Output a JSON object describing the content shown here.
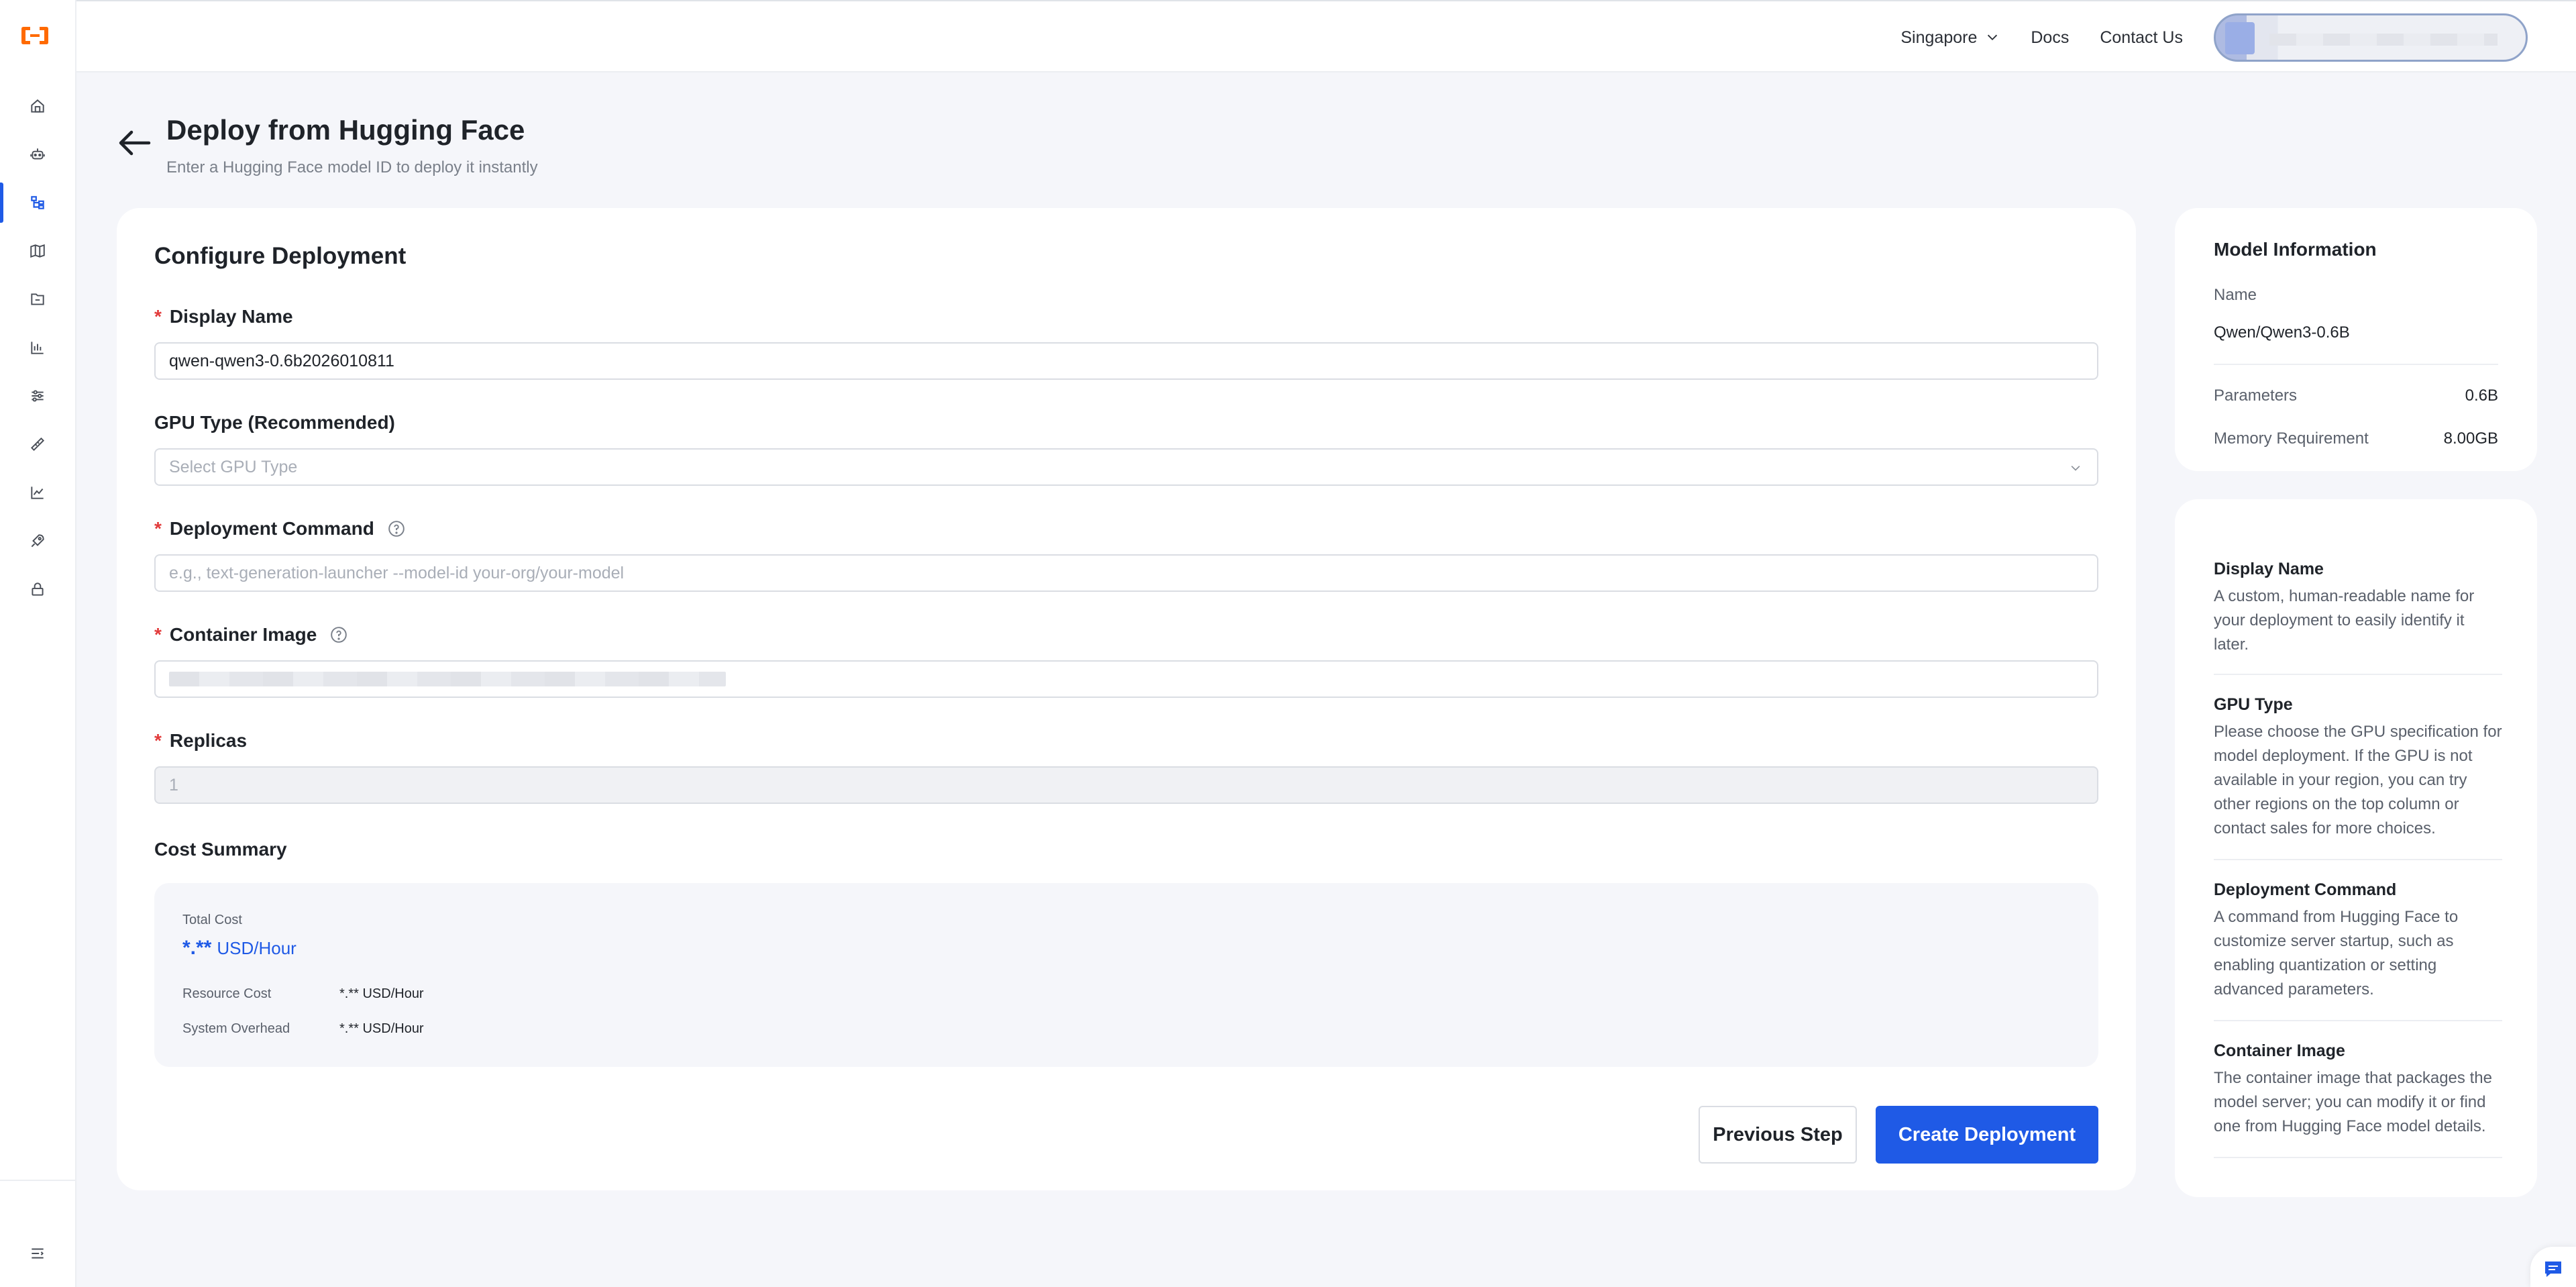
{
  "topbar": {
    "region": "Singapore",
    "docs": "Docs",
    "contact": "Contact Us"
  },
  "header": {
    "title": "Deploy from Hugging Face",
    "subtitle": "Enter a Hugging Face model ID to deploy it instantly"
  },
  "form": {
    "title": "Configure Deployment",
    "display_name": {
      "label": "Display Name",
      "value": "qwen-qwen3-0.6b2026010811"
    },
    "gpu_type": {
      "label": "GPU Type (Recommended)",
      "placeholder": "Select GPU Type"
    },
    "deployment_command": {
      "label": "Deployment Command",
      "placeholder": "e.g., text-generation-launcher --model-id your-org/your-model"
    },
    "container_image": {
      "label": "Container Image"
    },
    "replicas": {
      "label": "Replicas",
      "value": "1"
    }
  },
  "cost": {
    "title": "Cost Summary",
    "total_label": "Total Cost",
    "total_value": "*.**",
    "total_unit": "USD/Hour",
    "resource_label": "Resource Cost",
    "resource_value": "*.** USD/Hour",
    "overhead_label": "System Overhead",
    "overhead_value": "*.** USD/Hour"
  },
  "buttons": {
    "previous": "Previous Step",
    "create": "Create Deployment"
  },
  "model_info": {
    "title": "Model Information",
    "name_label": "Name",
    "name_value": "Qwen/Qwen3-0.6B",
    "params_label": "Parameters",
    "params_value": "0.6B",
    "memory_label": "Memory Requirement",
    "memory_value": "8.00GB"
  },
  "help": {
    "display_name_title": "Display Name",
    "display_name_text": "A custom, human-readable name for your deployment to easily identify it later.",
    "gpu_title": "GPU Type",
    "gpu_text": "Please choose the GPU specification for model deployment. If the GPU is not available in your region, you can try other regions on the top column or contact sales for more choices.",
    "command_title": "Deployment Command",
    "command_text": "A command from Hugging Face to customize server startup, such as enabling quantization or setting advanced parameters.",
    "image_title": "Container Image",
    "image_text": "The container image that packages the model server; you can modify it or find one from Hugging Face model details."
  },
  "colors": {
    "accent": "#1f5ae6",
    "logo": "#ff6a00",
    "required": "#e23b3b"
  },
  "icons": [
    "logo-icon",
    "home-icon",
    "robot-icon",
    "tree-icon",
    "map-icon",
    "folder-icon",
    "bar-chart-icon",
    "sliders-icon",
    "ruler-icon",
    "line-chart-icon",
    "rocket-icon",
    "lock-icon",
    "collapse-icon",
    "chevron-down-icon",
    "back-arrow-icon",
    "help-icon",
    "chat-icon"
  ]
}
